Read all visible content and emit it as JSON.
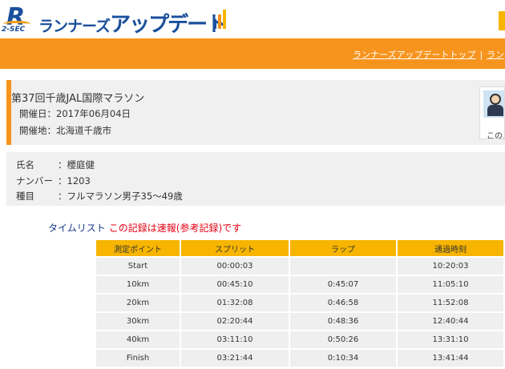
{
  "header": {
    "logo_sub": "2-SEC",
    "brand_small": "ランナーズ",
    "brand_big": "アップデート",
    "bar_colors": [
      "#1a4f9c",
      "#f7941d",
      "#f7b500"
    ]
  },
  "nav": {
    "links": [
      "ランナーズアップデートトップ",
      "ラン"
    ],
    "separator": "|"
  },
  "event": {
    "title": "第37回千歳JAL国際マラソン",
    "date_label": "開催日：",
    "date": "2017年06月04日",
    "place_label": "開催地：",
    "place": "北海道千歳市",
    "avatar_caption": "このス"
  },
  "runner": {
    "name_label": "氏名",
    "name": "：櫻庭健",
    "number_label": "ナンバー",
    "number": "：1203",
    "category_label": "種目",
    "category": "：フルマラソン男子35～49歳"
  },
  "time_list": {
    "heading": "タイムリスト",
    "note": "この記録は速報(参考記録)です",
    "columns": [
      "測定ポイント",
      "スプリット",
      "ラップ",
      "通過時刻"
    ],
    "rows": [
      [
        "Start",
        "00:00:03",
        "",
        "10:20:03"
      ],
      [
        "10km",
        "00:45:10",
        "0:45:07",
        "11:05:10"
      ],
      [
        "20km",
        "01:32:08",
        "0:46:58",
        "11:52:08"
      ],
      [
        "30km",
        "02:20:44",
        "0:48:36",
        "12:40:44"
      ],
      [
        "40km",
        "03:11:10",
        "0:50:26",
        "13:31:10"
      ],
      [
        "Finish",
        "03:21:44",
        "0:10:34",
        "13:41:44"
      ]
    ]
  },
  "colors": {
    "nav_orange": "#f7941d",
    "header_yellow": "#f7b500",
    "brand_blue": "#1a4f9c",
    "note_red": "#e60012"
  }
}
